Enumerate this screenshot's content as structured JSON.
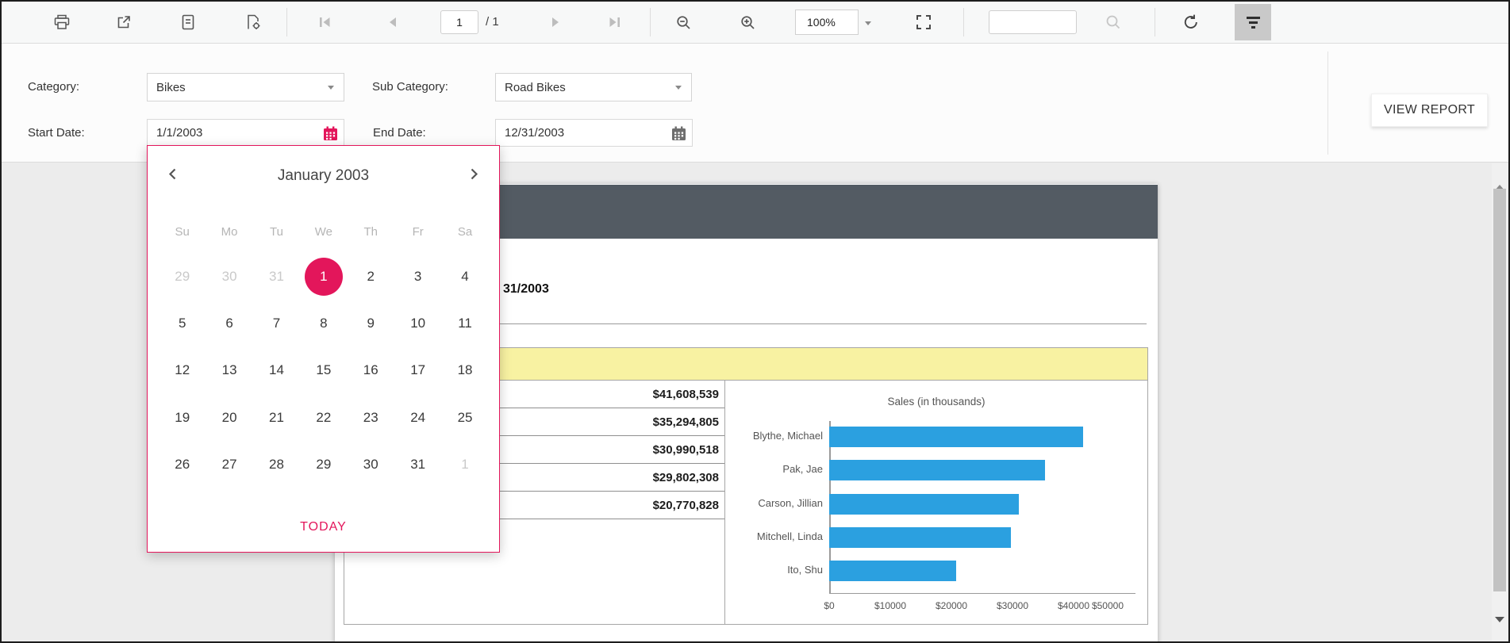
{
  "colors": {
    "accent_pink": "#e3165b",
    "bar_blue": "#2ba0e0",
    "report_band_dark": "#535b63",
    "table_header_yellow": "#f8f2a2"
  },
  "toolbar": {
    "icons": [
      "print",
      "export",
      "document",
      "document-settings",
      "first-page",
      "previous-page",
      "next-page",
      "last-page",
      "zoom-out",
      "zoom-in",
      "fit-to-page",
      "search",
      "refresh",
      "parameters"
    ],
    "page_number": "1",
    "page_total_label": "/ 1",
    "zoom_level": "100%",
    "search_placeholder": ""
  },
  "parameters": {
    "category_label": "Category:",
    "category_value": "Bikes",
    "subcategory_label": "Sub Category:",
    "subcategory_value": "Road Bikes",
    "start_date_label": "Start Date:",
    "start_date_value": "1/1/2003",
    "end_date_label": "End Date:",
    "end_date_value": "12/31/2003",
    "view_report_label": "VIEW REPORT"
  },
  "calendar": {
    "month_title": "January 2003",
    "day_headers": [
      "Su",
      "Mo",
      "Tu",
      "We",
      "Th",
      "Fr",
      "Sa"
    ],
    "weeks": [
      [
        {
          "d": "29",
          "muted": true
        },
        {
          "d": "30",
          "muted": true
        },
        {
          "d": "31",
          "muted": true
        },
        {
          "d": "1",
          "selected": true
        },
        {
          "d": "2"
        },
        {
          "d": "3"
        },
        {
          "d": "4"
        }
      ],
      [
        {
          "d": "5"
        },
        {
          "d": "6"
        },
        {
          "d": "7"
        },
        {
          "d": "8"
        },
        {
          "d": "9"
        },
        {
          "d": "10"
        },
        {
          "d": "11"
        }
      ],
      [
        {
          "d": "12"
        },
        {
          "d": "13"
        },
        {
          "d": "14"
        },
        {
          "d": "15"
        },
        {
          "d": "16"
        },
        {
          "d": "17"
        },
        {
          "d": "18"
        }
      ],
      [
        {
          "d": "19"
        },
        {
          "d": "20"
        },
        {
          "d": "21"
        },
        {
          "d": "22"
        },
        {
          "d": "23"
        },
        {
          "d": "24"
        },
        {
          "d": "25"
        }
      ],
      [
        {
          "d": "26"
        },
        {
          "d": "27"
        },
        {
          "d": "28"
        },
        {
          "d": "29"
        },
        {
          "d": "30"
        },
        {
          "d": "31"
        },
        {
          "d": "1",
          "muted": true
        }
      ]
    ],
    "today_label": "TODAY"
  },
  "report": {
    "title_fragment": "31/2003",
    "sales_values": [
      "$41,608,539",
      "$35,294,805",
      "$30,990,518",
      "$29,802,308",
      "$20,770,828"
    ]
  },
  "chart_data": {
    "type": "bar",
    "orientation": "horizontal",
    "title": "Sales (in thousands)",
    "categories": [
      "Blythe, Michael",
      "Pak, Jae",
      "Carson, Jillian",
      "Mitchell, Linda",
      "Ito, Shu"
    ],
    "values": [
      41608.539,
      35294.805,
      30990.518,
      29802.308,
      20770.828
    ],
    "x_tick_labels": [
      "$0",
      "$10000",
      "$20000",
      "$30000",
      "$40000",
      "$50000"
    ],
    "x_tick_values": [
      0,
      10000,
      20000,
      30000,
      40000,
      50000
    ],
    "xlim": [
      0,
      50000
    ],
    "grid": false,
    "legend": false
  }
}
